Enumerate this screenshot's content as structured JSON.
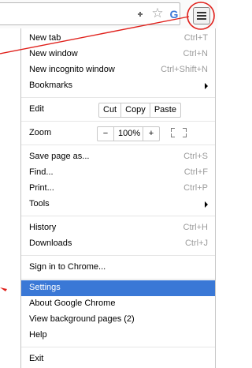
{
  "toolbar": {
    "extension_icon": "puzzle-extension-icon",
    "bookmark_icon": "star-icon",
    "extension_g_icon": "g-icon",
    "g_glyph": "G",
    "menu_icon": "hamburger-menu-icon"
  },
  "menu": {
    "new_tab": {
      "label": "New tab",
      "shortcut": "Ctrl+T"
    },
    "new_window": {
      "label": "New window",
      "shortcut": "Ctrl+N"
    },
    "new_incognito": {
      "label": "New incognito window",
      "shortcut": "Ctrl+Shift+N"
    },
    "bookmarks": {
      "label": "Bookmarks"
    },
    "edit": {
      "label": "Edit",
      "cut": "Cut",
      "copy": "Copy",
      "paste": "Paste"
    },
    "zoom": {
      "label": "Zoom",
      "minus": "−",
      "value": "100%",
      "plus": "+"
    },
    "save_page": {
      "label": "Save page as...",
      "shortcut": "Ctrl+S"
    },
    "find": {
      "label": "Find...",
      "shortcut": "Ctrl+F"
    },
    "print": {
      "label": "Print...",
      "shortcut": "Ctrl+P"
    },
    "tools": {
      "label": "Tools"
    },
    "history": {
      "label": "History",
      "shortcut": "Ctrl+H"
    },
    "downloads": {
      "label": "Downloads",
      "shortcut": "Ctrl+J"
    },
    "sign_in": {
      "label": "Sign in to Chrome..."
    },
    "settings": {
      "label": "Settings"
    },
    "about": {
      "label": "About Google Chrome"
    },
    "background_pages": {
      "label": "View background pages (2)"
    },
    "help": {
      "label": "Help"
    },
    "exit": {
      "label": "Exit"
    }
  },
  "colors": {
    "selected": "#3a78d6",
    "annotation": "#e0201b",
    "shortcut": "#9c9c9c"
  }
}
